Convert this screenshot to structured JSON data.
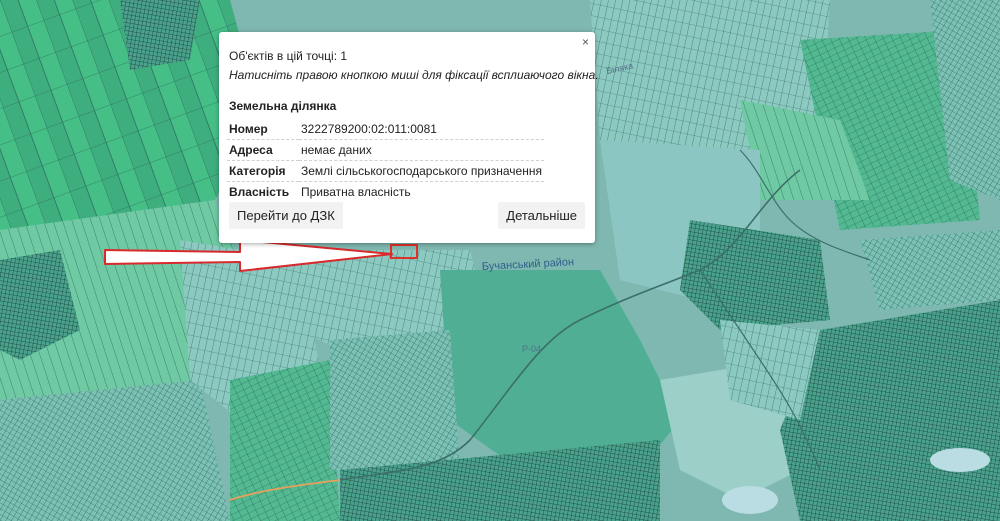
{
  "popup": {
    "objects_line": "Об'єктів в цій точці: 1",
    "hint_line": "Натисніть правою кнопкою миші для фіксації всплиаючого вікна.",
    "section_title": "Земельна ділянка",
    "rows": [
      {
        "key": "Номер",
        "value": "3222789200:02:011:0081"
      },
      {
        "key": "Адреса",
        "value": "немає даних"
      },
      {
        "key": "Категорія",
        "value": "Землі сільськогосподарського призначення"
      },
      {
        "key": "Власність",
        "value": "Приватна власність"
      }
    ],
    "goto_button": "Перейти до ДЗК",
    "details_button": "Детальніше",
    "close_symbol": "×"
  },
  "map": {
    "labels": {
      "district": "Бучанський район",
      "road": "Р-04",
      "village": "Біляка"
    },
    "colors": {
      "base": "#7fb8b0",
      "field_light": "#9ed4b8",
      "field_green": "#47c08b",
      "field_dark": "#2aa37a",
      "forest": "#4fae93",
      "parcel_line": "#1e5a55",
      "highlight": "#e0302a"
    }
  }
}
